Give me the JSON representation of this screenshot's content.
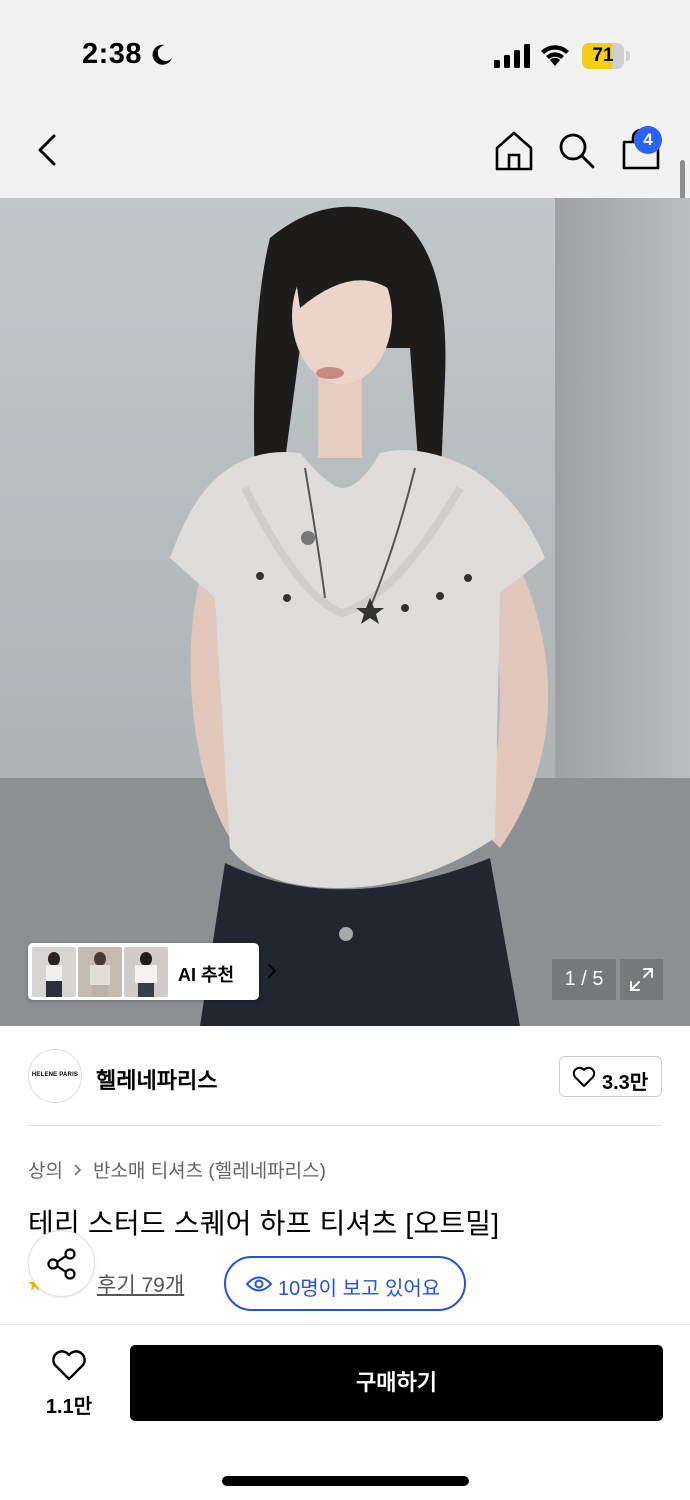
{
  "status_bar": {
    "time": "2:38",
    "battery": "71"
  },
  "nav": {
    "cart_count": "4"
  },
  "hero": {
    "ai_label": "AI 추천",
    "page_counter": "1 / 5"
  },
  "brand": {
    "name": "헬레네파리스",
    "logo_text": "HELENE PARIS",
    "likes": "3.3만"
  },
  "breadcrumb": {
    "category": "상의",
    "subcategory": "반소매 티셔츠 (헬레네파리스)"
  },
  "product": {
    "title": "테리 스터드 스퀘어 하프 티셔츠 [오트밀]",
    "reviews": "후기 79개",
    "viewers": "10명이 보고 있어요"
  },
  "bottom_bar": {
    "wish_count": "1.1만",
    "buy_label": "구매하기"
  },
  "colors": {
    "accent_blue": "#2452d8",
    "badge_blue": "#2a62f5",
    "battery_yellow": "#f2cd19",
    "buy_button": "#000000"
  },
  "icons": [
    "moon-icon",
    "cellular-signal-icon",
    "wifi-icon",
    "battery-icon",
    "back-chevron-icon",
    "home-icon",
    "search-icon",
    "shopping-bag-icon",
    "chevron-right-icon",
    "expand-icon",
    "heart-icon",
    "share-icon",
    "star-icon",
    "eye-icon"
  ]
}
